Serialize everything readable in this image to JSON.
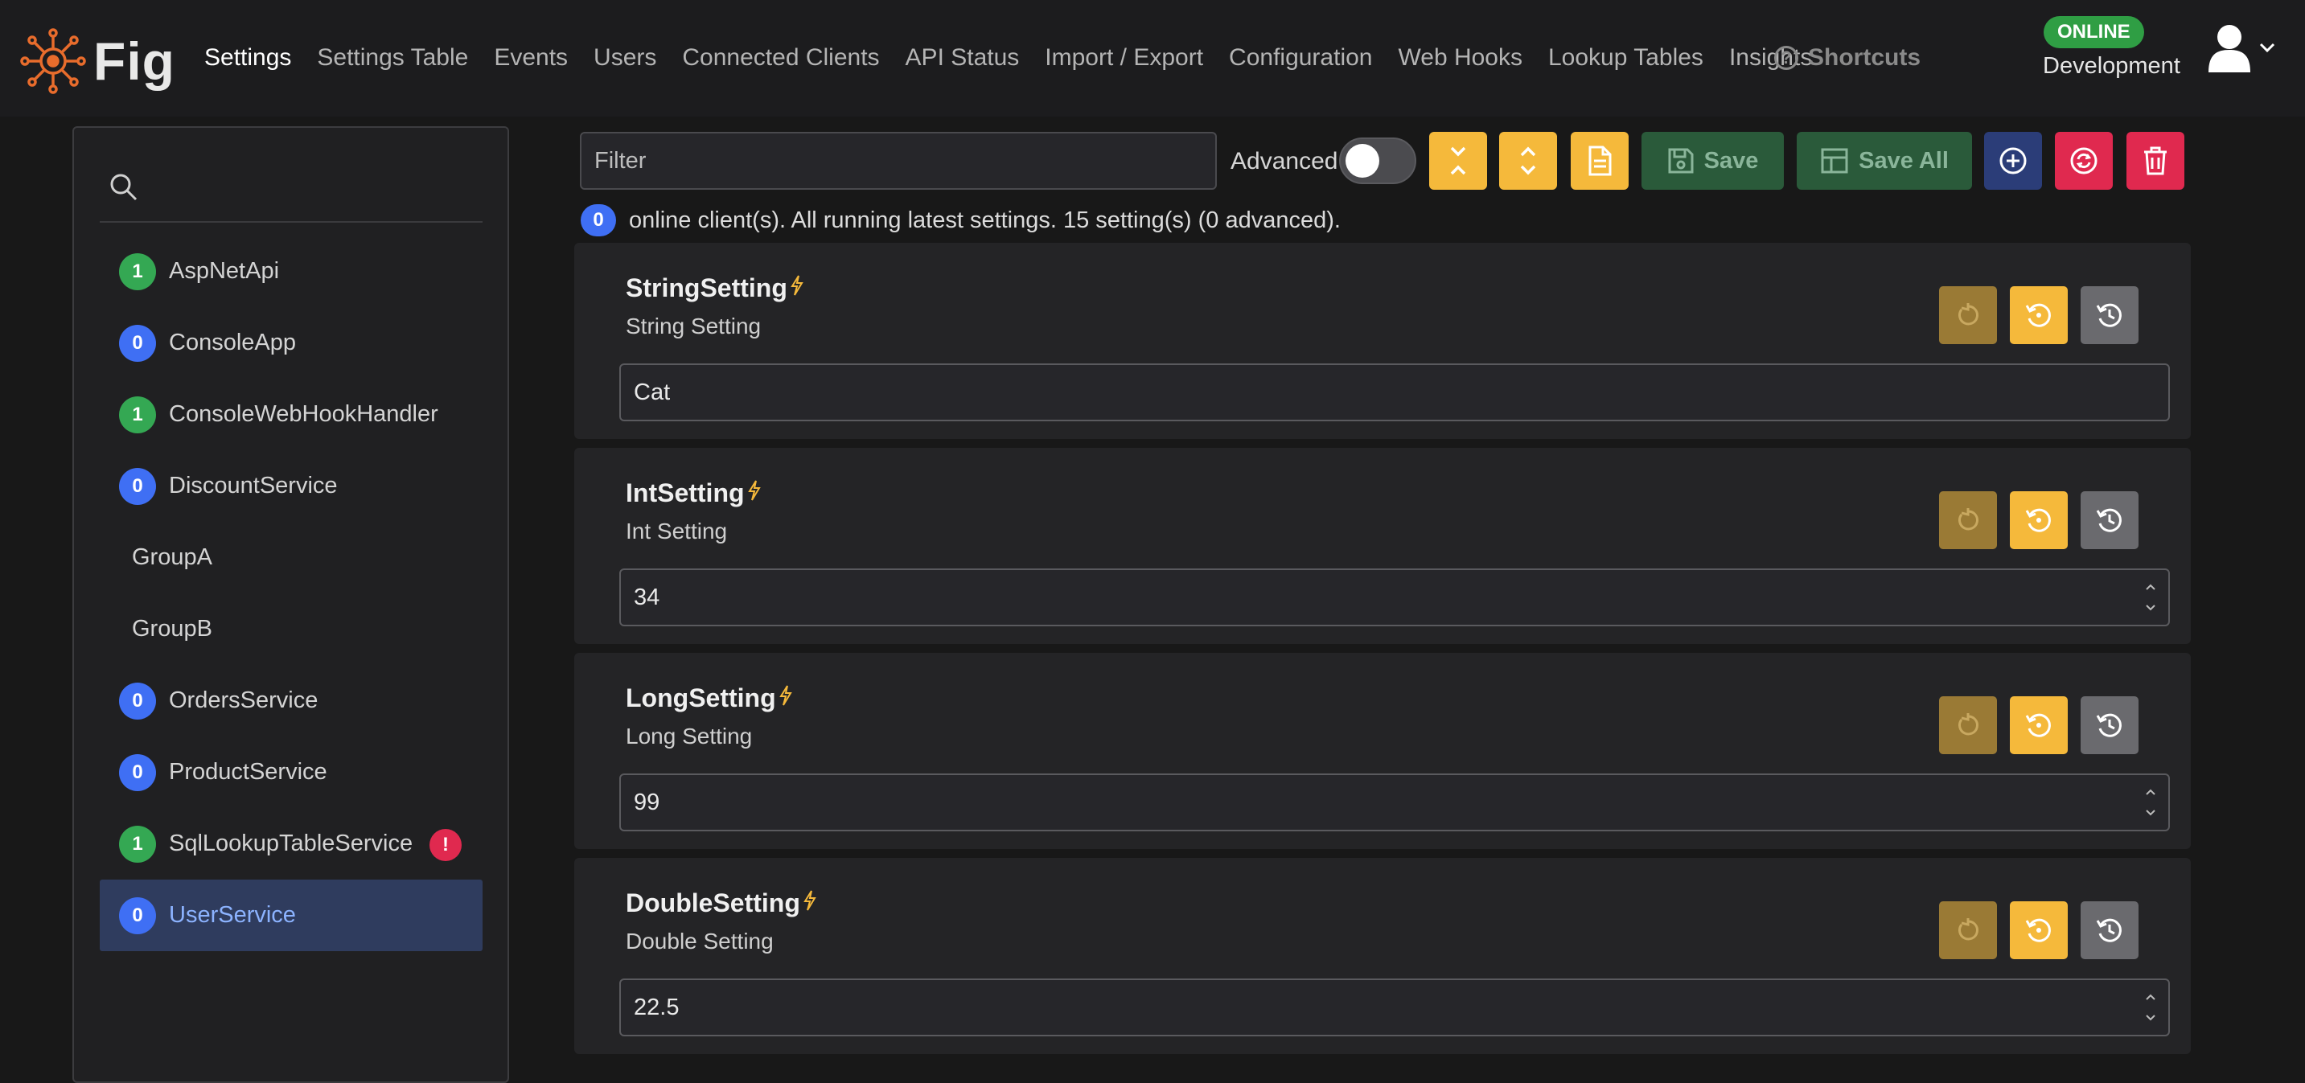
{
  "app": {
    "brand": "Fig"
  },
  "nav": {
    "items": [
      "Settings",
      "Settings Table",
      "Events",
      "Users",
      "Connected Clients",
      "API Status",
      "Import / Export",
      "Configuration",
      "Web Hooks",
      "Lookup Tables",
      "Insights"
    ],
    "active": "Settings",
    "shortcuts": "Shortcuts"
  },
  "status_badge": "ONLINE",
  "environment": "Development",
  "sidebar": {
    "items": [
      {
        "name": "AspNetApi",
        "count": "1",
        "color": "green"
      },
      {
        "name": "ConsoleApp",
        "count": "0",
        "color": "blue"
      },
      {
        "name": "ConsoleWebHookHandler",
        "count": "1",
        "color": "green"
      },
      {
        "name": "DiscountService",
        "count": "0",
        "color": "blue"
      },
      {
        "name": "GroupA",
        "count": "",
        "color": ""
      },
      {
        "name": "GroupB",
        "count": "",
        "color": ""
      },
      {
        "name": "OrdersService",
        "count": "0",
        "color": "blue"
      },
      {
        "name": "ProductService",
        "count": "0",
        "color": "blue"
      },
      {
        "name": "SqlLookupTableService",
        "count": "1",
        "color": "green",
        "alert": "!"
      },
      {
        "name": "UserService",
        "count": "0",
        "color": "blue",
        "selected": true
      }
    ]
  },
  "toolbar": {
    "filter_placeholder": "Filter",
    "advanced_label": "Advanced",
    "save_label": "Save",
    "save_all_label": "Save All"
  },
  "status": {
    "count": "0",
    "text": "online client(s). All running latest settings. 15 setting(s) (0 advanced)."
  },
  "settings": [
    {
      "name": "StringSetting",
      "description": "String Setting",
      "value": "Cat",
      "numeric": false
    },
    {
      "name": "IntSetting",
      "description": "Int Setting",
      "value": "34",
      "numeric": true
    },
    {
      "name": "LongSetting",
      "description": "Long Setting",
      "value": "99",
      "numeric": true
    },
    {
      "name": "DoubleSetting",
      "description": "Double Setting",
      "value": "22.5",
      "numeric": true
    }
  ],
  "colors": {
    "accent_yellow": "#f5b93b",
    "online_green": "#2f9e44",
    "count_blue": "#3f6ff4",
    "count_green": "#34a853",
    "danger_red": "#e0294f",
    "logo_orange": "#e86c2c"
  },
  "icons": [
    "fig-logo-icon",
    "help-icon",
    "user-avatar-icon",
    "chevron-down-icon",
    "search-icon",
    "collapse-all-icon",
    "expand-all-icon",
    "document-icon",
    "save-icon",
    "save-all-icon",
    "add-icon",
    "sync-icon",
    "trash-icon",
    "lightning-icon",
    "undo-icon",
    "reset-icon",
    "history-icon"
  ]
}
